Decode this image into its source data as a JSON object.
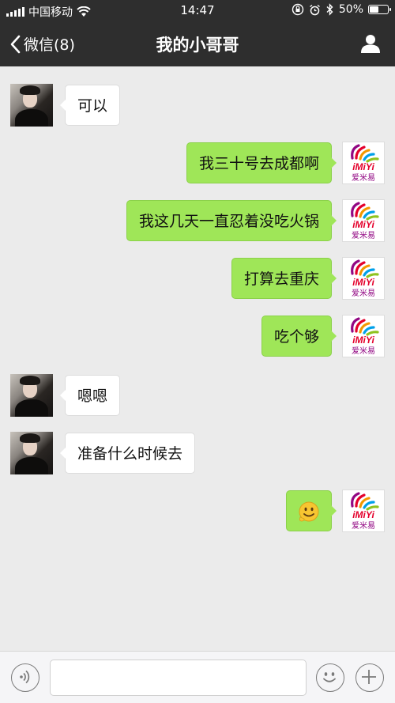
{
  "status_bar": {
    "carrier": "中国移动",
    "time": "14:47",
    "battery_text": "50%",
    "battery_level": 0.5
  },
  "nav": {
    "back_label": "微信(8)",
    "title": "我的小哥哥"
  },
  "messages": [
    {
      "side": "left",
      "text": "可以"
    },
    {
      "side": "right",
      "text": "我三十号去成都啊"
    },
    {
      "side": "right",
      "text": "我这几天一直忍着没吃火锅"
    },
    {
      "side": "right",
      "text": "打算去重庆"
    },
    {
      "side": "right",
      "text": "吃个够"
    },
    {
      "side": "left",
      "text": "嗯嗯"
    },
    {
      "side": "left",
      "text": "准备什么时候去"
    },
    {
      "side": "right",
      "emoji": "smiling-emoji"
    }
  ],
  "self_avatar": {
    "logo_text": "iMiYi",
    "logo_subtext": "爱米易",
    "colors": [
      "#e4002b",
      "#f39800",
      "#8fc31f",
      "#00a0e9",
      "#920783"
    ]
  },
  "colors": {
    "bubble_self": "#9fe658",
    "bubble_friend": "#ffffff",
    "header": "#2e2e2e",
    "chat_bg": "#ebebeb"
  }
}
